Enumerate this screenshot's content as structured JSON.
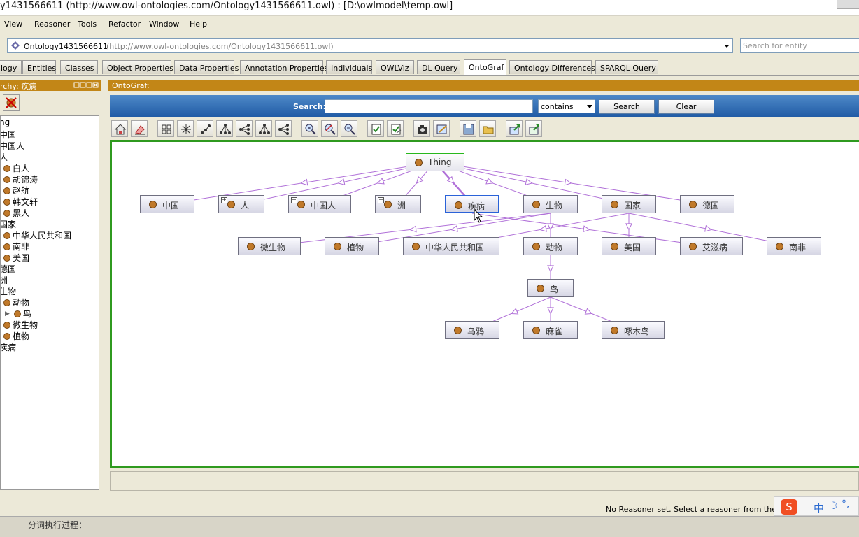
{
  "window": {
    "title": "y1431566611 (http://www.owl-ontologies.com/Ontology1431566611.owl)  : [D:\\owlmodel\\temp.owl]"
  },
  "menu": [
    "View",
    "Reasoner",
    "Tools",
    "Refactor",
    "Window",
    "Help"
  ],
  "ontology_bar": {
    "name": "Ontology1431566611",
    "iri": "(http://www.owl-ontologies.com/Ontology1431566611.owl)",
    "search_placeholder": "Search for entity"
  },
  "tabs": [
    {
      "label": "logy",
      "active": false
    },
    {
      "label": "Entities",
      "active": false
    },
    {
      "label": "Classes",
      "active": false
    },
    {
      "label": "Object Properties",
      "active": false
    },
    {
      "label": "Data Properties",
      "active": false
    },
    {
      "label": "Annotation Properties",
      "active": false
    },
    {
      "label": "Individuals",
      "active": false
    },
    {
      "label": "OWLViz",
      "active": false
    },
    {
      "label": "DL Query",
      "active": false
    },
    {
      "label": "OntoGraf",
      "active": true
    },
    {
      "label": "Ontology Differences",
      "active": false
    },
    {
      "label": "SPARQL Query",
      "active": false
    }
  ],
  "left_panel": {
    "title": "rchy: 疾病",
    "tree": [
      {
        "label": "ng",
        "dot": false
      },
      {
        "label": "中国",
        "dot": false
      },
      {
        "label": "中国人",
        "dot": false
      },
      {
        "label": "人",
        "dot": false
      },
      {
        "label": "白人",
        "dot": true
      },
      {
        "label": "胡锦涛",
        "dot": true
      },
      {
        "label": "赵航",
        "dot": true
      },
      {
        "label": "韩文轩",
        "dot": true
      },
      {
        "label": "黑人",
        "dot": true
      },
      {
        "label": "国家",
        "dot": false
      },
      {
        "label": "中华人民共和国",
        "dot": true
      },
      {
        "label": "南非",
        "dot": true
      },
      {
        "label": "美国",
        "dot": true
      },
      {
        "label": "德国",
        "dot": false
      },
      {
        "label": "洲",
        "dot": false
      },
      {
        "label": "生物",
        "dot": false
      },
      {
        "label": "动物",
        "dot": true
      },
      {
        "label": "鸟",
        "dot": true
      },
      {
        "label": "微生物",
        "dot": true
      },
      {
        "label": "植物",
        "dot": true
      },
      {
        "label": "疾病",
        "dot": false
      }
    ]
  },
  "ontograf": {
    "title": "OntoGraf:",
    "search_label": "Search:",
    "search_value": "",
    "search_mode": "contains",
    "search_button": "Search",
    "clear_button": "Clear",
    "toolbar_icons": [
      "home-icon",
      "eraser-icon",
      "grid-layout-icon",
      "radial-layout-icon",
      "spring-layout-icon",
      "tree-vertical-icon",
      "tree-horizontal-icon",
      "tree-vertical-icon",
      "tree-horizontal-icon",
      "zoom-in-icon",
      "zoom-reset-icon",
      "zoom-out-icon",
      "filter-nodes-icon",
      "filter-arcs-icon",
      "camera-icon",
      "notes-icon",
      "save-icon",
      "open-folder-icon",
      "export-icon",
      "export-image-icon"
    ],
    "nodes": {
      "thing": "Thing",
      "china": "中国",
      "person": "人",
      "chinese": "中国人",
      "continent": "洲",
      "disease": "疾病",
      "organism": "生物",
      "country": "国家",
      "germany": "德国",
      "microbe": "微生物",
      "plant": "植物",
      "prc": "中华人民共和国",
      "animal": "动物",
      "usa": "美国",
      "aids": "艾滋病",
      "south_africa": "南非",
      "bird": "鸟",
      "crow": "乌鸦",
      "sparrow": "麻雀",
      "woodpecker": "啄木鸟"
    }
  },
  "status": {
    "reasoner": "No Reasoner set. Select a reasoner from the Rea",
    "task": "分词执行过程："
  },
  "colors": {
    "panel_header": "#c28617",
    "search_bar": "#2a66ad",
    "canvas_border": "#2f9a1f",
    "edge": "#b070d8",
    "node_dot": "#c0792a",
    "selected_border": "#2a62d8"
  }
}
